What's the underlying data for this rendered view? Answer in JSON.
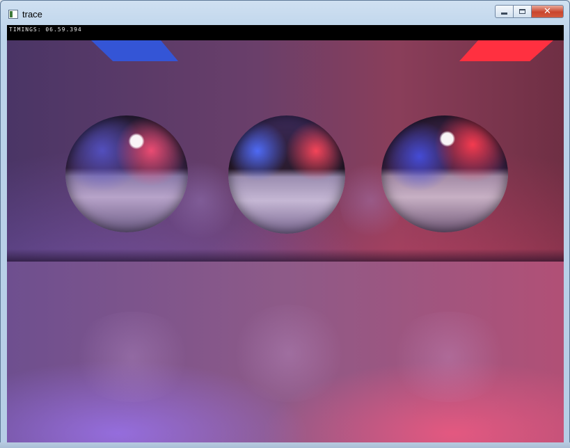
{
  "window": {
    "title": "trace",
    "buttons": {
      "minimize_icon": "minimize-icon",
      "maximize_icon": "maximize-icon",
      "close_label": "✕"
    }
  },
  "status": {
    "timings_label": "TIMINGS:",
    "timings_value": "06.59.394"
  },
  "colors": {
    "left_light": "#3455d6",
    "right_light": "#ff3040",
    "status_bar_bg": "#000000"
  }
}
